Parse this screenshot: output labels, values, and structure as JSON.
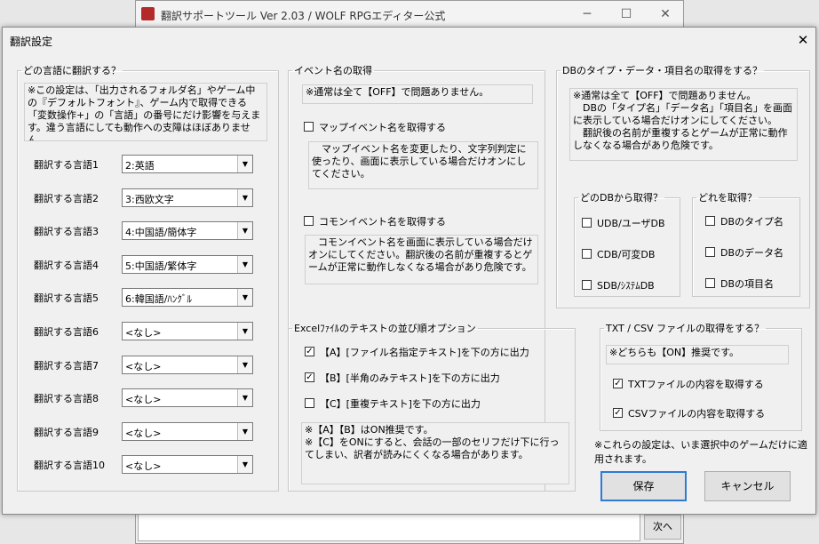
{
  "bg_window": {
    "title": "翻訳サポートツール Ver 2.03 / WOLF RPGエディター公式",
    "minimize_icon": "minimize-icon",
    "maximize_icon": "maximize-icon",
    "close_glyph": "✕",
    "next_button": "次へ"
  },
  "dialog": {
    "title": "翻訳設定",
    "close_glyph": "✕",
    "language_group": {
      "legend": "どの言語に翻訳する？",
      "note": "※この設定は、「出力されるフォルダ名」やゲーム中の『デフォルトフォント』、ゲーム内で取得できる「変数操作+」の「言語」の番号にだけ影響を与えます。違う言語にしても動作への支障はほぼありません。",
      "rows": [
        {
          "label": "翻訳する言語1",
          "value": "2:英語"
        },
        {
          "label": "翻訳する言語2",
          "value": "3:西欧文字"
        },
        {
          "label": "翻訳する言語3",
          "value": "4:中国語/簡体字"
        },
        {
          "label": "翻訳する言語4",
          "value": "5:中国語/繁体字"
        },
        {
          "label": "翻訳する言語5",
          "value": "6:韓国語/ﾊﾝｸﾞﾙ"
        },
        {
          "label": "翻訳する言語6",
          "value": "<なし>"
        },
        {
          "label": "翻訳する言語7",
          "value": "<なし>"
        },
        {
          "label": "翻訳する言語8",
          "value": "<なし>"
        },
        {
          "label": "翻訳する言語9",
          "value": "<なし>"
        },
        {
          "label": "翻訳する言語10",
          "value": "<なし>"
        }
      ],
      "dropdown_glyph": "▼"
    },
    "event_group": {
      "legend": "イベント名の取得",
      "note": "※通常は全て【OFF】で問題ありません。",
      "map_event_label": "マップイベント名を取得する",
      "map_event_checked": false,
      "map_event_note": "　マップイベント名を変更したり、文字列判定に使ったり、画面に表示している場合だけオンにしてください。",
      "common_event_label": "コモンイベント名を取得する",
      "common_event_checked": false,
      "common_event_note": "　コモンイベント名を画面に表示している場合だけオンにしてください。翻訳後の名前が重複するとゲームが正常に動作しなくなる場合があり危険です。"
    },
    "db_group": {
      "legend": "DBのタイプ・データ・項目名の取得をする？",
      "note": "※通常は全て【OFF】で問題ありません。\n　DBの「タイプ名」「データ名」「項目名」を画面に表示している場合だけオンにしてください。\n　翻訳後の名前が重複するとゲームが正常に動作しなくなる場合があり危険です。",
      "which_db": {
        "legend": "どのDBから取得？",
        "items": [
          {
            "label": "UDB/ユーザDB",
            "checked": false
          },
          {
            "label": "CDB/可変DB",
            "checked": false
          },
          {
            "label": "SDB/ｼｽﾃﾑDB",
            "checked": false
          }
        ]
      },
      "which_item": {
        "legend": "どれを取得？",
        "items": [
          {
            "label": "DBのタイプ名",
            "checked": false
          },
          {
            "label": "DBのデータ名",
            "checked": false
          },
          {
            "label": "DBの項目名",
            "checked": false
          }
        ]
      }
    },
    "excel_group": {
      "legend": "Excelﾌｧｲﾙのテキストの並び順オプション",
      "items": [
        {
          "label": "【A】[ファイル名指定テキスト]を下の方に出力",
          "checked": true
        },
        {
          "label": "【B】[半角のみテキスト]を下の方に出力",
          "checked": true
        },
        {
          "label": "【C】[重複テキスト]を下の方に出力",
          "checked": false
        }
      ],
      "note": "※【A】【B】はON推奨です。\n※【C】をONにすると、会話の一部のセリフだけ下に行ってしまい、訳者が読みにくくなる場合があります。"
    },
    "txt_group": {
      "legend": "TXT / CSV ファイルの取得をする？",
      "note": "※どちらも【ON】推奨です。",
      "items": [
        {
          "label": "TXTファイルの内容を取得する",
          "checked": true
        },
        {
          "label": "CSVファイルの内容を取得する",
          "checked": true
        }
      ]
    },
    "footer_note": "※これらの設定は、いま選択中のゲームだけに適用されます。",
    "save_button": "保存",
    "cancel_button": "キャンセル",
    "check_glyph": "✓"
  }
}
